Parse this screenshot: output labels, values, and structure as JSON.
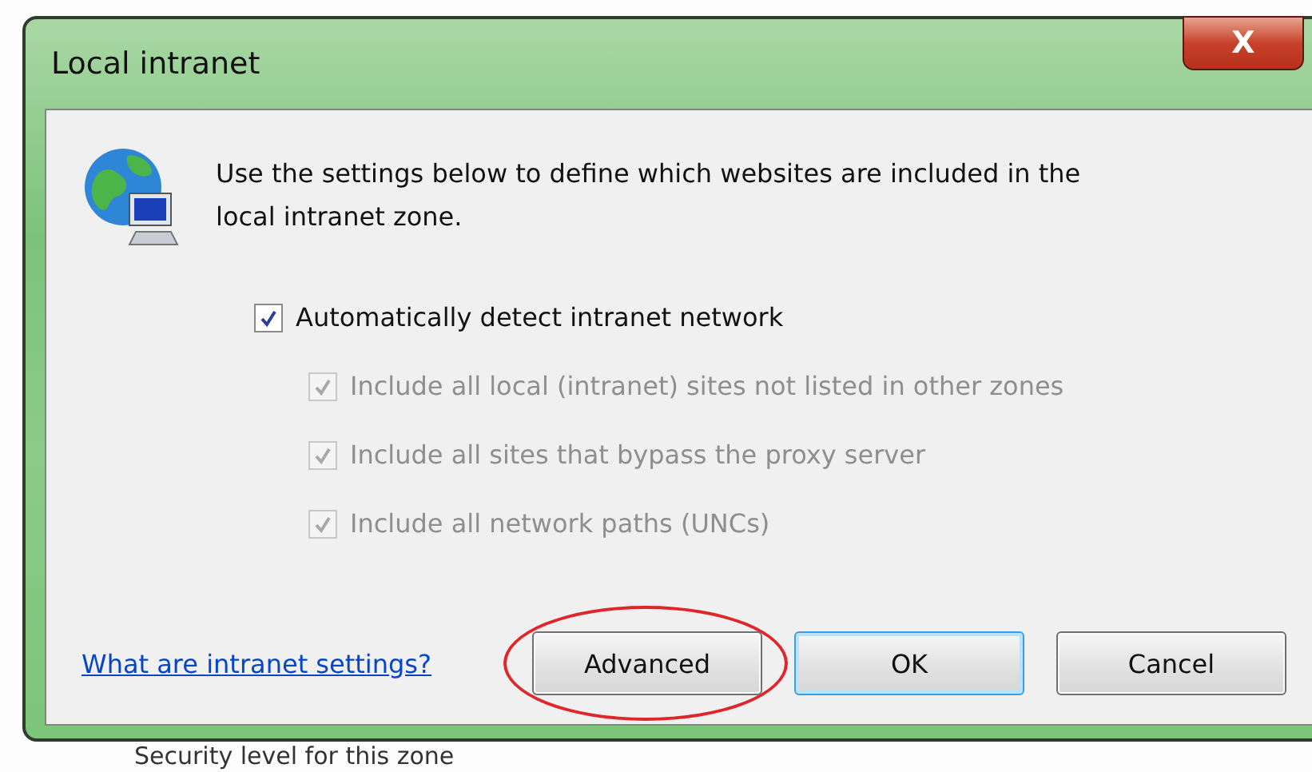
{
  "window": {
    "title": "Local intranet",
    "close_label": "X"
  },
  "description": "Use the settings below to define which websites are included in the local intranet zone.",
  "options": [
    {
      "label": "Automatically detect intranet network",
      "checked": true,
      "disabled": false,
      "children": [
        {
          "label": "Include all local (intranet) sites not listed in other zones",
          "checked": true,
          "disabled": true
        },
        {
          "label": "Include all sites that bypass the proxy server",
          "checked": true,
          "disabled": true
        },
        {
          "label": "Include all network paths (UNCs)",
          "checked": true,
          "disabled": true
        }
      ]
    }
  ],
  "help_link": "What are intranet settings?",
  "buttons": [
    {
      "label": "Advanced",
      "kind": "normal",
      "highlighted": true
    },
    {
      "label": "OK",
      "kind": "default",
      "highlighted": false
    },
    {
      "label": "Cancel",
      "kind": "normal",
      "highlighted": false
    }
  ],
  "background_text": "Security level for this zone"
}
